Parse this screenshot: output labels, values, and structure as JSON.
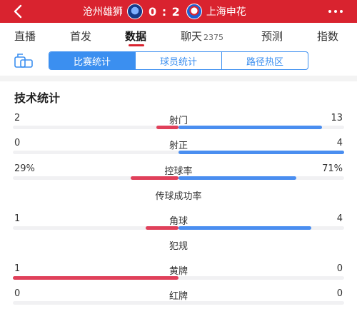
{
  "header": {
    "home_team": "沧州雄狮",
    "away_team": "上海申花",
    "score": "0 : 2",
    "colors": {
      "bar_bg": "#d9232f",
      "home_color": "#e0405a",
      "away_color": "#4a8ef0"
    }
  },
  "tabs": [
    {
      "label": "直播"
    },
    {
      "label": "首发"
    },
    {
      "label": "数据",
      "active": true
    },
    {
      "label": "聊天",
      "count": "2375"
    },
    {
      "label": "预测"
    },
    {
      "label": "指数"
    }
  ],
  "segments": [
    {
      "label": "比赛统计",
      "active": true
    },
    {
      "label": "球员统计"
    },
    {
      "label": "路径热区"
    }
  ],
  "section_title": "技术统计",
  "stats": [
    {
      "name": "射门",
      "home": "2",
      "away": "13",
      "home_pct": 0.133,
      "away_pct": 0.867
    },
    {
      "name": "射正",
      "home": "0",
      "away": "4",
      "home_pct": 0.0,
      "away_pct": 1.0
    },
    {
      "name": "控球率",
      "home": "29%",
      "away": "71%",
      "home_pct": 0.29,
      "away_pct": 0.71
    },
    {
      "name": "传球成功率",
      "home": "",
      "away": ""
    },
    {
      "name": "角球",
      "home": "1",
      "away": "4",
      "home_pct": 0.2,
      "away_pct": 0.8
    },
    {
      "name": "犯规",
      "home": "",
      "away": ""
    },
    {
      "name": "黄牌",
      "home": "1",
      "away": "0",
      "home_pct": 1.0,
      "away_pct": 0.0
    },
    {
      "name": "红牌",
      "home": "0",
      "away": "0",
      "home_pct": 0.0,
      "away_pct": 0.0
    }
  ]
}
